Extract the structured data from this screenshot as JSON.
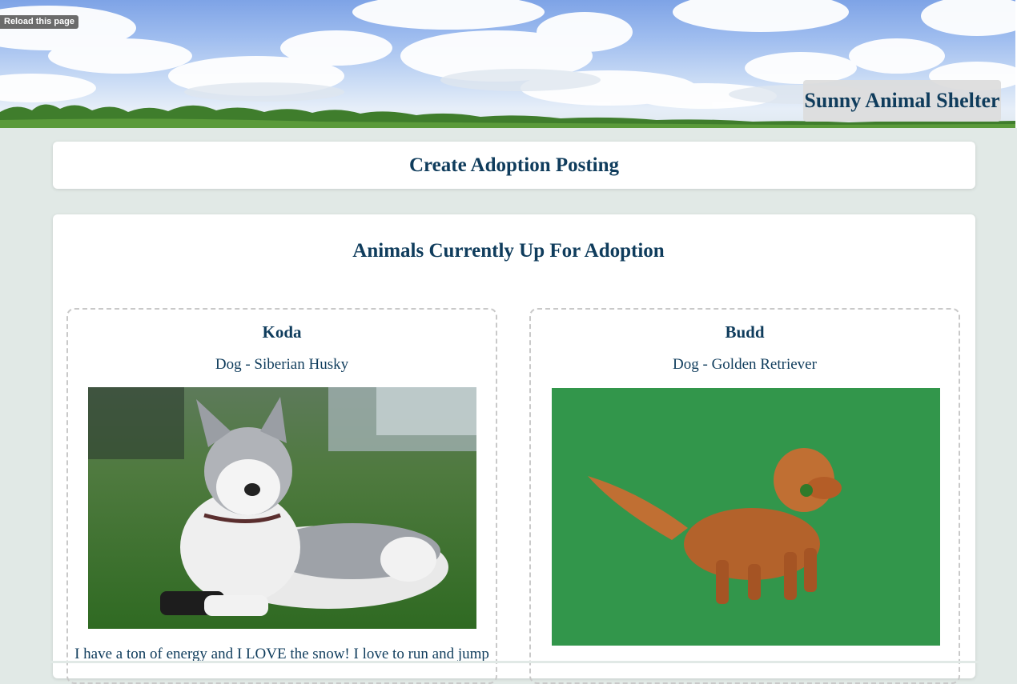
{
  "toolbar": {
    "reload_label": "Reload this page"
  },
  "header": {
    "shelter_name": "Sunny Animal Shelter"
  },
  "create_posting": {
    "label": "Create Adoption Posting"
  },
  "adoption_list": {
    "title": "Animals Currently Up For Adoption",
    "animals": [
      {
        "name": "Koda",
        "breed": "Dog - Siberian Husky",
        "photo_subject": "husky-dog-photo",
        "description": "I have a ton of energy and I LOVE the snow! I love to run and jump"
      },
      {
        "name": "Budd",
        "breed": "Dog - Golden Retriever",
        "photo_subject": "golden-retriever-dog-photo",
        "description": ""
      }
    ]
  }
}
